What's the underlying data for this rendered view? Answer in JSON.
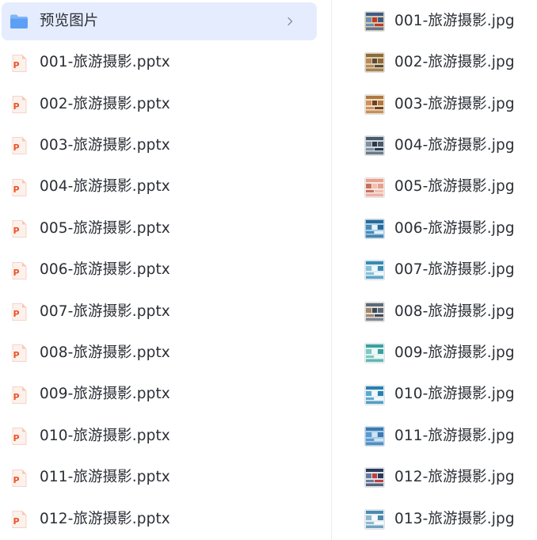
{
  "folder": {
    "name": "预览图片",
    "icon": "folder-icon",
    "chevron_icon": "chevron-right-icon",
    "color": "#5d9ff5"
  },
  "left_files": [
    {
      "name": "001-旅游摄影.pptx",
      "icon": "pptx-icon"
    },
    {
      "name": "002-旅游摄影.pptx",
      "icon": "pptx-icon"
    },
    {
      "name": "003-旅游摄影.pptx",
      "icon": "pptx-icon"
    },
    {
      "name": "004-旅游摄影.pptx",
      "icon": "pptx-icon"
    },
    {
      "name": "005-旅游摄影.pptx",
      "icon": "pptx-icon"
    },
    {
      "name": "006-旅游摄影.pptx",
      "icon": "pptx-icon"
    },
    {
      "name": "007-旅游摄影.pptx",
      "icon": "pptx-icon"
    },
    {
      "name": "008-旅游摄影.pptx",
      "icon": "pptx-icon"
    },
    {
      "name": "009-旅游摄影.pptx",
      "icon": "pptx-icon"
    },
    {
      "name": "010-旅游摄影.pptx",
      "icon": "pptx-icon"
    },
    {
      "name": "011-旅游摄影.pptx",
      "icon": "pptx-icon"
    },
    {
      "name": "012-旅游摄影.pptx",
      "icon": "pptx-icon"
    }
  ],
  "right_files": [
    {
      "name": "001-旅游摄影.jpg",
      "icon": "image-thumbnail-icon"
    },
    {
      "name": "002-旅游摄影.jpg",
      "icon": "image-thumbnail-icon"
    },
    {
      "name": "003-旅游摄影.jpg",
      "icon": "image-thumbnail-icon"
    },
    {
      "name": "004-旅游摄影.jpg",
      "icon": "image-thumbnail-icon"
    },
    {
      "name": "005-旅游摄影.jpg",
      "icon": "image-thumbnail-icon"
    },
    {
      "name": "006-旅游摄影.jpg",
      "icon": "image-thumbnail-icon"
    },
    {
      "name": "007-旅游摄影.jpg",
      "icon": "image-thumbnail-icon"
    },
    {
      "name": "008-旅游摄影.jpg",
      "icon": "image-thumbnail-icon"
    },
    {
      "name": "009-旅游摄影.jpg",
      "icon": "image-thumbnail-icon"
    },
    {
      "name": "010-旅游摄影.jpg",
      "icon": "image-thumbnail-icon"
    },
    {
      "name": "011-旅游摄影.jpg",
      "icon": "image-thumbnail-icon"
    },
    {
      "name": "012-旅游摄影.jpg",
      "icon": "image-thumbnail-icon"
    },
    {
      "name": "013-旅游摄影.jpg",
      "icon": "image-thumbnail-icon"
    }
  ],
  "colors": {
    "selected_row_bg": "#e5ecfd",
    "pptx_accent": "#e8572b",
    "text": "#2b2f36"
  }
}
